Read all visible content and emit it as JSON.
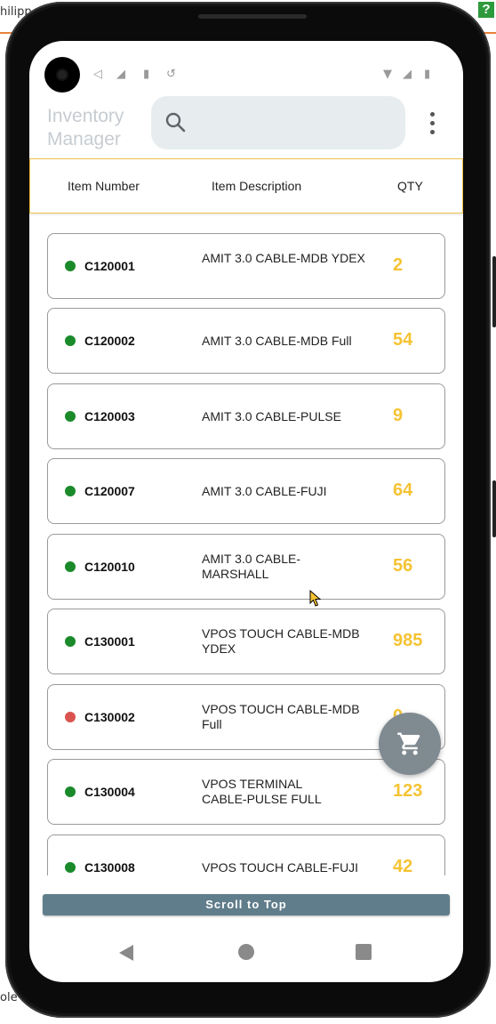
{
  "background": {
    "top_text": "hilipp",
    "bottom_text": "ole",
    "help_badge": "?",
    "accent_color": "#e8833a"
  },
  "app": {
    "title": "Inventory Manager",
    "search": {
      "placeholder": "",
      "value": "",
      "icon": "search-icon"
    },
    "menu_icon": "more-vert-icon"
  },
  "table": {
    "headers": {
      "item_number": "Item Number",
      "item_description": "Item Description",
      "qty": "QTY"
    },
    "rows": [
      {
        "status": "in-stock",
        "status_color": "#1a8a2a",
        "item_number": "C120001",
        "description": "AMIT 3.0 CABLE-MDB YDEX",
        "qty": "2"
      },
      {
        "status": "in-stock",
        "status_color": "#1a8a2a",
        "item_number": "C120002",
        "description": "AMIT 3.0 CABLE-MDB Full",
        "qty": "54"
      },
      {
        "status": "in-stock",
        "status_color": "#1a8a2a",
        "item_number": "C120003",
        "description": "AMIT 3.0 CABLE-PULSE",
        "qty": "9"
      },
      {
        "status": "in-stock",
        "status_color": "#1a8a2a",
        "item_number": "C120007",
        "description": "AMIT 3.0 CABLE-FUJI",
        "qty": "64"
      },
      {
        "status": "in-stock",
        "status_color": "#1a8a2a",
        "item_number": "C120010",
        "description": "AMIT 3.0 CABLE-MARSHALL",
        "qty": "56"
      },
      {
        "status": "in-stock",
        "status_color": "#1a8a2a",
        "item_number": "C130001",
        "description": "VPOS TOUCH CABLE-MDB YDEX",
        "qty": "985"
      },
      {
        "status": "out-of-stock",
        "status_color": "#d9534f",
        "item_number": "C130002",
        "description": "VPOS TOUCH CABLE-MDB Full",
        "qty": "0"
      },
      {
        "status": "in-stock",
        "status_color": "#1a8a2a",
        "item_number": "C130004",
        "description": "VPOS TERMINAL CABLE-PULSE FULL",
        "qty": "123"
      },
      {
        "status": "in-stock",
        "status_color": "#1a8a2a",
        "item_number": "C130008",
        "description": "VPOS TOUCH CABLE-FUJI",
        "qty": "42"
      }
    ]
  },
  "fab": {
    "icon": "shopping-cart-icon"
  },
  "scroll_to_top": {
    "label": "Scroll to Top"
  },
  "colors": {
    "qty": "#f5c333",
    "header_border": "#f0c24a",
    "scroll_button": "#607d8b",
    "fab": "#7f8a91",
    "in_stock": "#1a8a2a",
    "out_of_stock": "#d9534f"
  }
}
